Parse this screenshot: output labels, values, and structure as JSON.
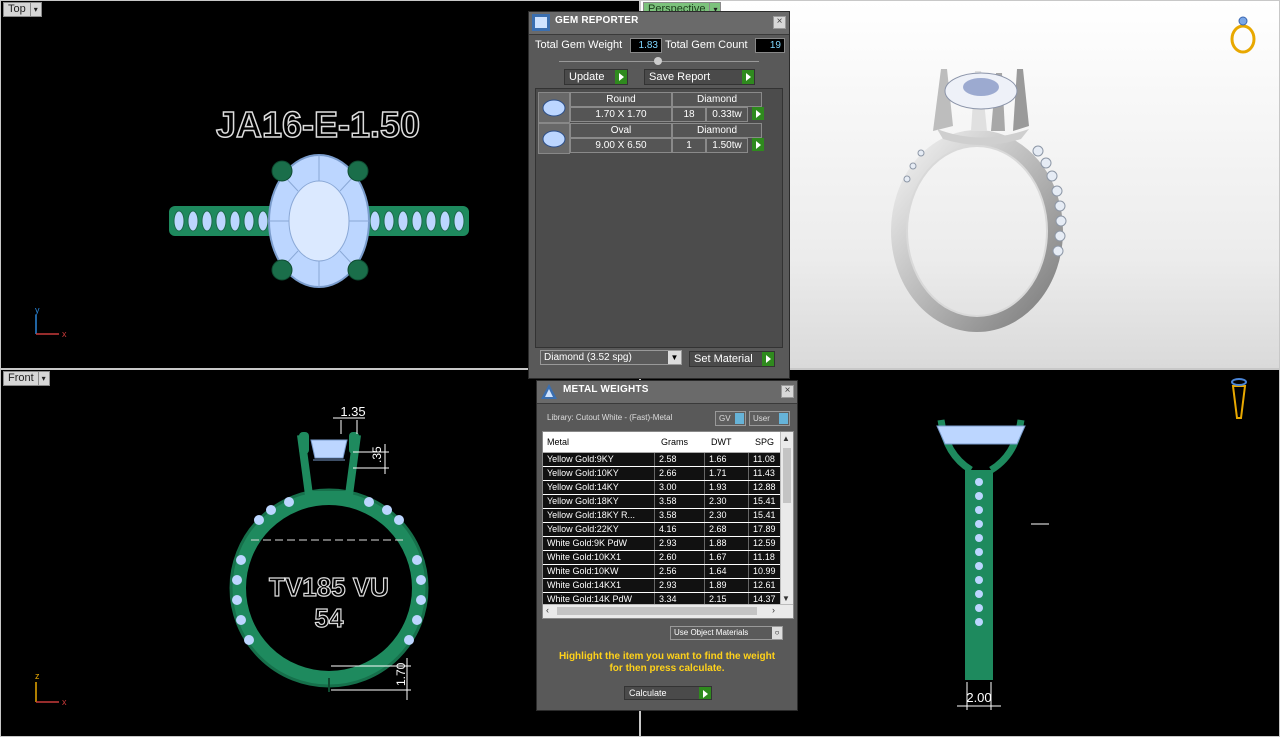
{
  "viewports": {
    "top": {
      "label": "Top",
      "ring_engraving": "JA16-E-1.50",
      "axis_y": "y",
      "axis_x": "x"
    },
    "perspective": {
      "label": "Perspective"
    },
    "front": {
      "label": "Front",
      "engraving_line1": "TV185 VU",
      "engraving_line2": "54",
      "dim_top": "1.35",
      "dim_side": ".35",
      "dim_bottom": "1.70",
      "axis_z": "z",
      "axis_x": "x"
    },
    "right": {
      "dim_bottom": "2.00"
    }
  },
  "gem_reporter": {
    "title": "GEM REPORTER",
    "total_weight_label": "Total Gem Weight",
    "total_weight_value": "1.83",
    "total_count_label": "Total Gem Count",
    "total_count_value": "19",
    "update_label": "Update",
    "save_report_label": "Save Report",
    "rows": [
      {
        "shape": "Round",
        "material": "Diamond",
        "size": "1.70 X 1.70",
        "count": "18",
        "weight": "0.33tw"
      },
      {
        "shape": "Oval",
        "material": "Diamond",
        "size": "9.00 X 6.50",
        "count": "1",
        "weight": "1.50tw"
      }
    ],
    "material_select": "Diamond     (3.52 spg)",
    "set_material_label": "Set Material"
  },
  "metal_weights": {
    "title": "METAL WEIGHTS",
    "library": "Library: Cutout White - (Fast)-Metal",
    "toggle_gv": "GV",
    "toggle_user": "User",
    "columns": [
      "Metal",
      "Grams",
      "DWT",
      "SPG"
    ],
    "rows": [
      [
        "Yellow Gold:9KY",
        "2.58",
        "1.66",
        "11.08"
      ],
      [
        "Yellow Gold:10KY",
        "2.66",
        "1.71",
        "11.43"
      ],
      [
        "Yellow Gold:14KY",
        "3.00",
        "1.93",
        "12.88"
      ],
      [
        "Yellow Gold:18KY",
        "3.58",
        "2.30",
        "15.41"
      ],
      [
        "Yellow Gold:18KY R...",
        "3.58",
        "2.30",
        "15.41"
      ],
      [
        "Yellow Gold:22KY",
        "4.16",
        "2.68",
        "17.89"
      ],
      [
        "White Gold:9K PdW",
        "2.93",
        "1.88",
        "12.59"
      ],
      [
        "White Gold:10KX1",
        "2.60",
        "1.67",
        "11.18"
      ],
      [
        "White Gold:10KW",
        "2.56",
        "1.64",
        "10.99"
      ],
      [
        "White Gold:14KX1",
        "2.93",
        "1.89",
        "12.61"
      ],
      [
        "White Gold:14K PdW",
        "3.34",
        "2.15",
        "14.37"
      ]
    ],
    "use_object_materials": "Use Object Materials",
    "hint_line1": "Highlight the item you want to find the weight",
    "hint_line2": "for then press calculate.",
    "calculate_label": "Calculate"
  },
  "colors": {
    "ring_green": "#1e8a5e",
    "ring_green_light": "#2aa874",
    "gem_blue": "#bcd6ff",
    "hint_yellow": "#ffd21a",
    "arrow_green": "#2f8a1e"
  }
}
